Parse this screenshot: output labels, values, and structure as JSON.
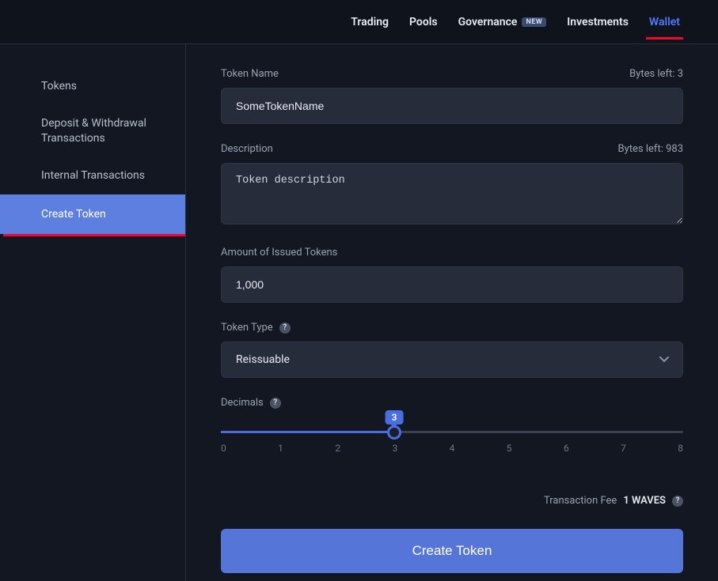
{
  "nav": {
    "items": [
      {
        "label": "Trading"
      },
      {
        "label": "Pools"
      },
      {
        "label": "Governance",
        "badge": "NEW"
      },
      {
        "label": "Investments"
      },
      {
        "label": "Wallet",
        "active": true
      }
    ]
  },
  "sidebar": {
    "items": [
      {
        "label": "Tokens"
      },
      {
        "label": "Deposit & Withdrawal Transactions"
      },
      {
        "label": "Internal Transactions"
      },
      {
        "label": "Create Token",
        "active": true
      }
    ]
  },
  "form": {
    "tokenName": {
      "label": "Token Name",
      "hint": "Bytes left: 3",
      "value": "SomeTokenName"
    },
    "description": {
      "label": "Description",
      "hint": "Bytes left: 983",
      "value": "Token description"
    },
    "amount": {
      "label": "Amount of Issued Tokens",
      "value": "1,000"
    },
    "tokenType": {
      "label": "Token Type",
      "value": "Reissuable"
    },
    "decimals": {
      "label": "Decimals",
      "value": 3,
      "min": 0,
      "max": 8,
      "ticks": [
        "0",
        "1",
        "2",
        "3",
        "4",
        "5",
        "6",
        "7",
        "8"
      ]
    },
    "fee": {
      "label": "Transaction Fee",
      "amount": "1 WAVES"
    },
    "submit": "Create Token"
  },
  "helpGlyph": "?"
}
